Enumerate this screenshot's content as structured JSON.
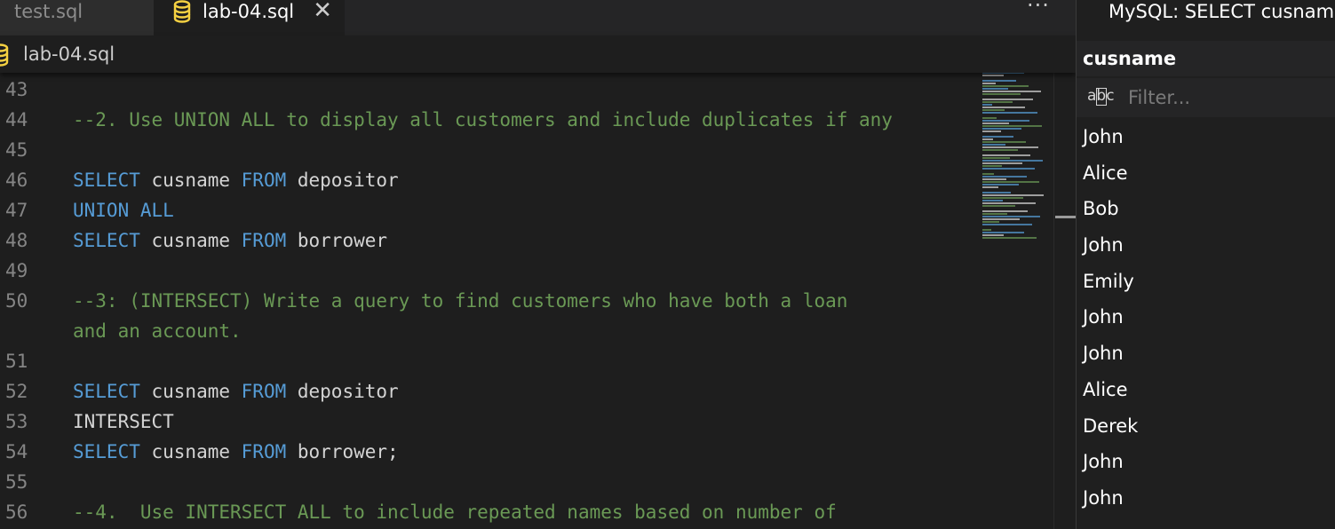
{
  "tabs": [
    {
      "label": "test.sql",
      "active": false
    },
    {
      "label": "lab-04.sql",
      "active": true
    }
  ],
  "icons": {
    "database": "database-icon",
    "close": "close-icon",
    "more": "more-actions-icon",
    "abc": "abc-text-icon"
  },
  "more_label": "···",
  "close_glyph": "✕",
  "breadcrumb": {
    "file": "lab-04.sql"
  },
  "code_lines": [
    {
      "num": "43",
      "tokens": []
    },
    {
      "num": "44",
      "tokens": [
        {
          "t": "--2. Use UNION ALL to display all customers and include duplicates if any",
          "c": "comment"
        }
      ]
    },
    {
      "num": "45",
      "tokens": []
    },
    {
      "num": "46",
      "tokens": [
        {
          "t": "SELECT",
          "c": "kw"
        },
        {
          "t": " cusname ",
          "c": "plain"
        },
        {
          "t": "FROM",
          "c": "kw"
        },
        {
          "t": " depositor",
          "c": "plain"
        }
      ]
    },
    {
      "num": "47",
      "tokens": [
        {
          "t": "UNION ALL",
          "c": "kw"
        }
      ]
    },
    {
      "num": "48",
      "tokens": [
        {
          "t": "SELECT",
          "c": "kw"
        },
        {
          "t": " cusname ",
          "c": "plain"
        },
        {
          "t": "FROM",
          "c": "kw"
        },
        {
          "t": " borrower",
          "c": "plain"
        }
      ]
    },
    {
      "num": "49",
      "tokens": []
    },
    {
      "num": "50",
      "tokens": [
        {
          "t": "--3: (INTERSECT) Write a query to find customers who have both a loan",
          "c": "comment"
        }
      ]
    },
    {
      "num": "",
      "tokens": [
        {
          "t": "and an account.",
          "c": "comment"
        }
      ]
    },
    {
      "num": "51",
      "tokens": []
    },
    {
      "num": "52",
      "tokens": [
        {
          "t": "SELECT",
          "c": "kw"
        },
        {
          "t": " cusname ",
          "c": "plain"
        },
        {
          "t": "FROM",
          "c": "kw"
        },
        {
          "t": " depositor",
          "c": "plain"
        }
      ]
    },
    {
      "num": "53",
      "tokens": [
        {
          "t": "INTERSECT",
          "c": "plain"
        }
      ]
    },
    {
      "num": "54",
      "tokens": [
        {
          "t": "SELECT",
          "c": "kw"
        },
        {
          "t": " cusname ",
          "c": "plain"
        },
        {
          "t": "FROM",
          "c": "kw"
        },
        {
          "t": " borrower;",
          "c": "plain"
        }
      ]
    },
    {
      "num": "55",
      "tokens": []
    },
    {
      "num": "56",
      "tokens": [
        {
          "t": "--4.  Use INTERSECT ALL to include repeated names based on number of",
          "c": "comment"
        }
      ]
    }
  ],
  "colors": {
    "comment": "#6a9955",
    "keyword": "#569cd6",
    "plain": "#d4d4d4",
    "line_number": "#858585",
    "db_icon": "#f5d142"
  },
  "results": {
    "title": "MySQL: SELECT cusname",
    "column": "cusname",
    "filter_placeholder": "Filter...",
    "abc_label": "abc",
    "rows": [
      "John",
      "Alice",
      "Bob",
      "John",
      "Emily",
      "John",
      "John",
      "Alice",
      "Derek",
      "John",
      "John"
    ]
  }
}
